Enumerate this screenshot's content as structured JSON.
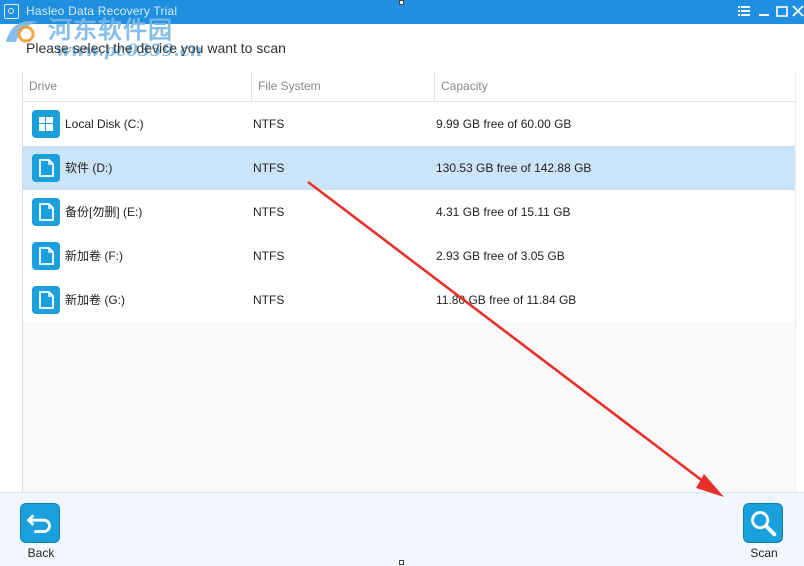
{
  "window": {
    "title": "Hasleo Data Recovery Trial",
    "controls": [
      "menu-icon",
      "minimize-icon",
      "restore-icon",
      "close-icon"
    ]
  },
  "watermark": {
    "cn_text": "河东软件园",
    "url": "www.pc0359.cn"
  },
  "prompt": "Please select the device you want to scan",
  "table": {
    "columns": [
      "Drive",
      "File System",
      "Capacity"
    ],
    "rows": [
      {
        "icon": "windows-drive-icon",
        "name": "Local Disk (C:)",
        "fs": "NTFS",
        "capacity": "9.99 GB free of 60.00 GB",
        "selected": false
      },
      {
        "icon": "document-drive-icon",
        "name": "软件 (D:)",
        "fs": "NTFS",
        "capacity": "130.53 GB free of 142.88 GB",
        "selected": true
      },
      {
        "icon": "document-drive-icon",
        "name": "备份[勿删] (E:)",
        "fs": "NTFS",
        "capacity": "4.31 GB free of 15.11 GB",
        "selected": false
      },
      {
        "icon": "document-drive-icon",
        "name": "新加卷 (F:)",
        "fs": "NTFS",
        "capacity": "2.93 GB free of 3.05 GB",
        "selected": false
      },
      {
        "icon": "document-drive-icon",
        "name": "新加卷 (G:)",
        "fs": "NTFS",
        "capacity": "11.80 GB free of 11.84 GB",
        "selected": false
      }
    ]
  },
  "footer": {
    "back_label": "Back",
    "scan_label": "Scan"
  },
  "colors": {
    "accent": "#1aa0dc",
    "titlebar": "#1f8fe0",
    "selected_row": "#cce4f7",
    "annotation_arrow": "#e8302a"
  }
}
